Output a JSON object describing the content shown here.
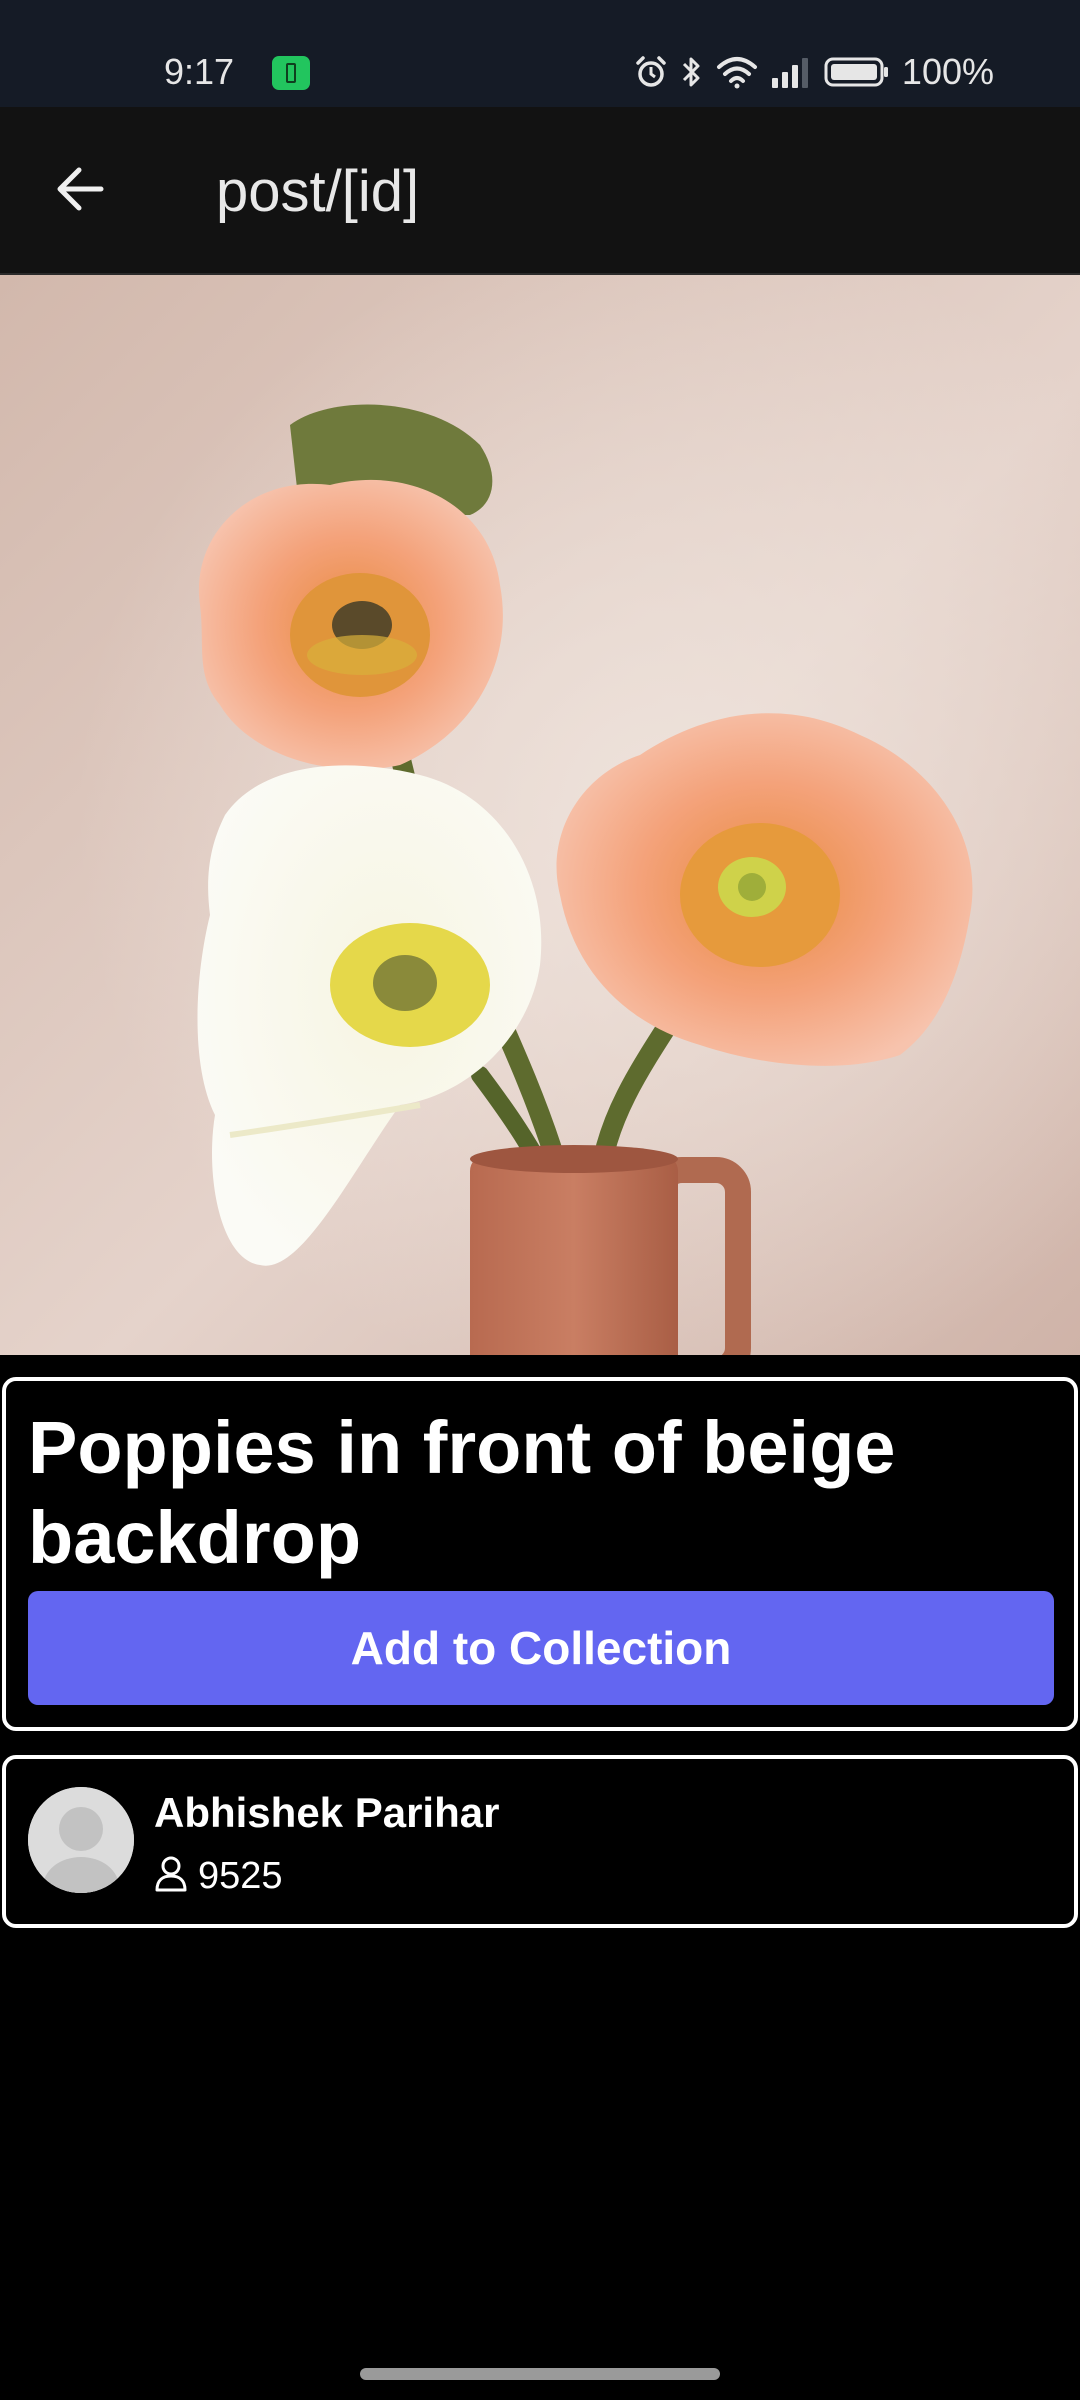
{
  "status_bar": {
    "time": "9:17",
    "battery_percent": "100%",
    "icons": [
      "battery-saver-icon",
      "alarm-icon",
      "bluetooth-icon",
      "wifi-icon",
      "signal-icon",
      "battery-icon"
    ]
  },
  "app_bar": {
    "title": "post/[id]",
    "back_icon": "arrow-left-icon"
  },
  "post": {
    "title": "Poppies in front of beige backdrop",
    "add_button_label": "Add to Collection"
  },
  "author": {
    "name": "Abhishek Parihar",
    "followers": "9525",
    "follower_icon": "user-icon"
  },
  "colors": {
    "accent": "#6366f1",
    "status_bar_bg": "#151b26",
    "app_bar_bg": "#121212",
    "page_bg": "#000000",
    "card_border": "#ffffff"
  }
}
